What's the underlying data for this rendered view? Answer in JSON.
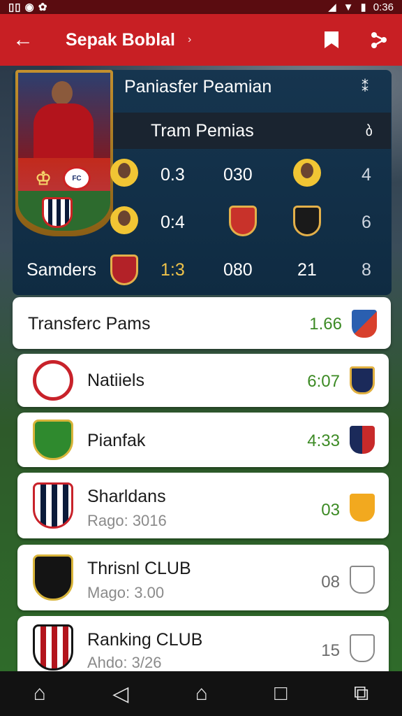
{
  "status": {
    "left_icons": "▯▯  ◉  ✿",
    "time": "0:36"
  },
  "app_bar": {
    "title": "Sepak Boblal",
    "chevron": "›"
  },
  "panel": {
    "title": "Paniasfer Peamian",
    "sub_header": "Tram Pemias",
    "rows": [
      {
        "a": "0.3",
        "b": "030",
        "c": "",
        "d": "4"
      },
      {
        "a": "0:4",
        "b": "",
        "c": "",
        "d": "6"
      },
      {
        "name": "Samders",
        "a": "1:3",
        "b": "080",
        "c": "21",
        "d": "8"
      }
    ]
  },
  "list": [
    {
      "name": "Transferc Pams",
      "sub": "",
      "score": "1.66",
      "score_color": "#3c8a24"
    },
    {
      "name": "Natiiels",
      "sub": "",
      "score": "6:07",
      "score_color": "#3c8a24"
    },
    {
      "name": "Pianfak",
      "sub": "",
      "score": "4:33",
      "score_color": "#3c8a24"
    },
    {
      "name": "Sharldans",
      "sub": "Rago: 3016",
      "score": "03",
      "score_color": "#3c8a24"
    },
    {
      "name": "Thrisnl CLUB",
      "sub": "Mago: 3.00",
      "score": "08",
      "score_color": "#6b6b6b"
    },
    {
      "name": "Ranking CLUB",
      "sub": "Ahdo: 3/26",
      "score": "15",
      "score_color": "#6b6b6b"
    }
  ],
  "nav": {
    "home": "⌂",
    "back": "◁",
    "house": "⌂",
    "square": "□",
    "recents": "⧉"
  }
}
